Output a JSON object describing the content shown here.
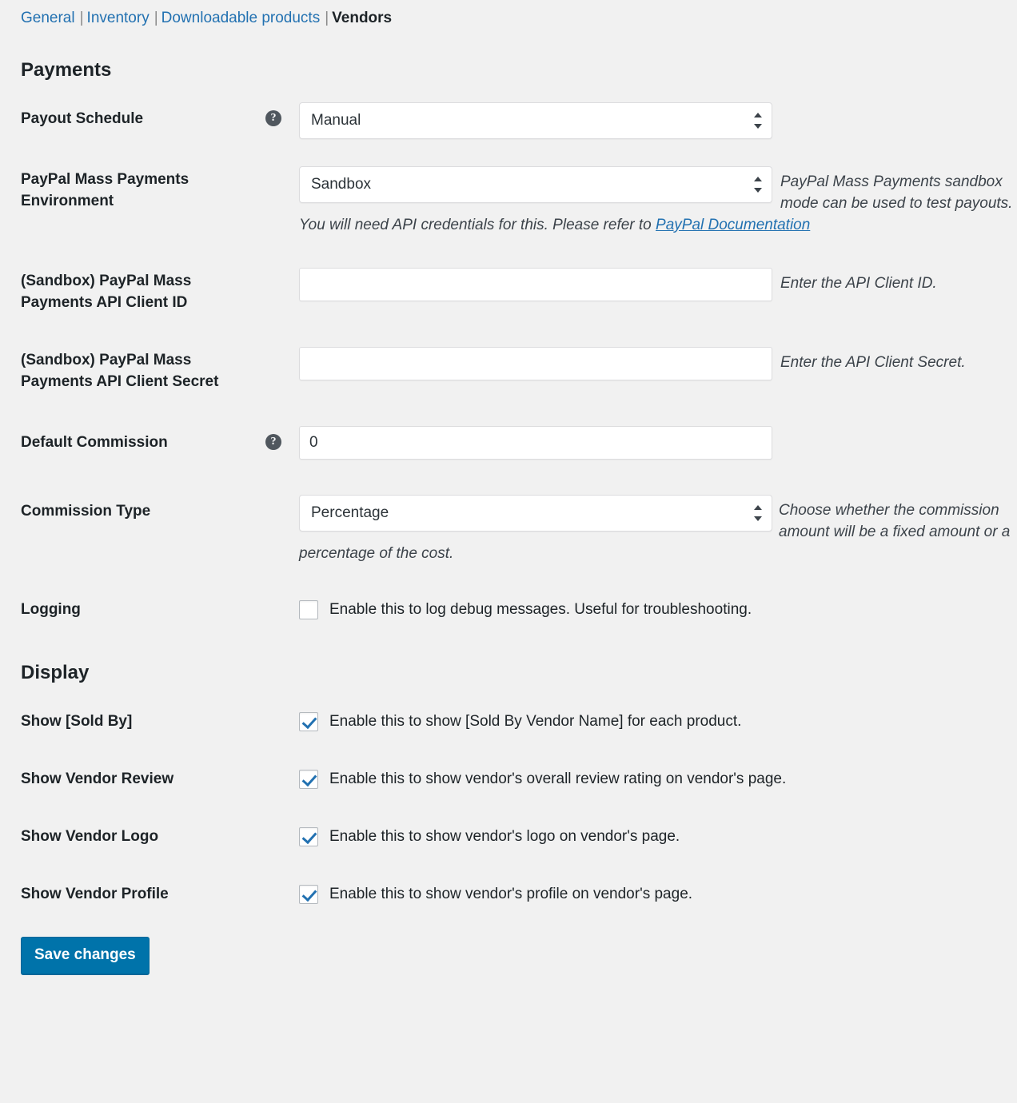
{
  "tabs": [
    {
      "label": "General",
      "current": false
    },
    {
      "label": "Inventory",
      "current": false
    },
    {
      "label": "Downloadable products",
      "current": false
    },
    {
      "label": "Vendors",
      "current": true
    }
  ],
  "separator": "|",
  "sections": {
    "payments_title": "Payments",
    "display_title": "Display"
  },
  "help_icon_glyph": "?",
  "rows": {
    "payout_schedule": {
      "label": "Payout Schedule",
      "value": "Manual",
      "has_help": true
    },
    "paypal_environment": {
      "label": "PayPal Mass Payments Environment",
      "value": "Sandbox",
      "desc_pre": "PayPal Mass Payments sandbox mode can be used to test payouts. You will need API credentials for this. Please refer to ",
      "desc_link": "PayPal Documentation"
    },
    "api_client_id": {
      "label": "(Sandbox) PayPal Mass Payments API Client ID",
      "value": "",
      "desc": "Enter the API Client ID."
    },
    "api_client_secret": {
      "label": "(Sandbox) PayPal Mass Payments API Client Secret",
      "value": "",
      "desc": "Enter the API Client Secret."
    },
    "default_commission": {
      "label": "Default Commission",
      "value": "0",
      "has_help": true
    },
    "commission_type": {
      "label": "Commission Type",
      "value": "Percentage",
      "desc": "Choose whether the commission amount will be a fixed amount or a percentage of the cost."
    },
    "logging": {
      "label": "Logging",
      "checkbox_label": "Enable this to log debug messages. Useful for troubleshooting.",
      "checked": false
    },
    "show_sold_by": {
      "label": "Show [Sold By]",
      "checkbox_label": "Enable this to show [Sold By Vendor Name] for each product.",
      "checked": true
    },
    "show_vendor_review": {
      "label": "Show Vendor Review",
      "checkbox_label": "Enable this to show vendor's overall review rating on vendor's page.",
      "checked": true
    },
    "show_vendor_logo": {
      "label": "Show Vendor Logo",
      "checkbox_label": "Enable this to show vendor's logo on vendor's page.",
      "checked": true
    },
    "show_vendor_profile": {
      "label": "Show Vendor Profile",
      "checkbox_label": "Enable this to show vendor's profile on vendor's page.",
      "checked": true
    }
  },
  "save": {
    "label": "Save changes"
  },
  "colors": {
    "link": "#2271b1",
    "primary_button": "#0073aa",
    "page_background": "#f1f1f1",
    "checkbox_check": "#2271b1"
  }
}
